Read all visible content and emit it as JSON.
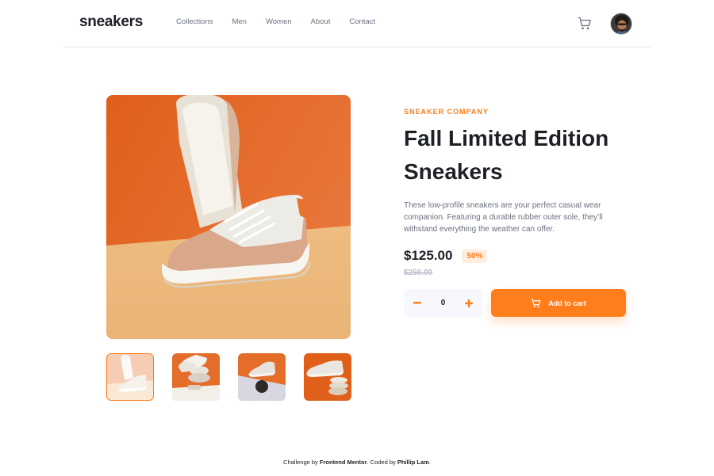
{
  "header": {
    "logo": "sneakers",
    "nav": [
      "Collections",
      "Men",
      "Women",
      "About",
      "Contact"
    ],
    "cart_icon": "cart-icon",
    "avatar": "avatar"
  },
  "gallery": {
    "main_image": "product-image-1",
    "thumbnails": [
      "product-thumbnail-1",
      "product-thumbnail-2",
      "product-thumbnail-3",
      "product-thumbnail-4"
    ],
    "active_thumbnail": 0
  },
  "product": {
    "company": "SNEAKER COMPANY",
    "title": "Fall Limited Edition Sneakers",
    "description": "These low-profile sneakers are your perfect casual wear companion. Featuring a durable rubber outer sole, they’ll withstand everything the weather can offer.",
    "price": "$125.00",
    "discount": "50%",
    "original_price": "$250.00",
    "quantity": "0",
    "minus_icon": "minus-icon",
    "plus_icon": "plus-icon",
    "add_to_cart_label": "Add to cart"
  },
  "footer": {
    "prefix": "Challenge by ",
    "challenge_by": "Frontend Mentor",
    "middle": ". Coded by ",
    "coded_by": "Phillip Lam",
    "suffix": "."
  },
  "colors": {
    "accent": "#ff7d1a",
    "accent_pale": "#ffede0",
    "text_dark": "#1d2026",
    "text_gray": "#69707d",
    "text_light": "#b6bcc8",
    "input_bg": "#f7f8fd"
  }
}
